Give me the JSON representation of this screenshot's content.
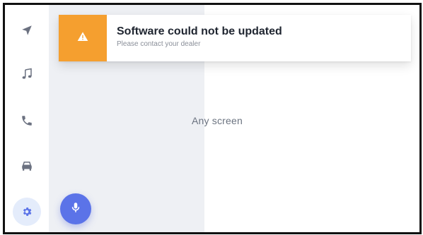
{
  "colors": {
    "accent": "#5b73e8",
    "warning": "#f59f2f",
    "active_bg": "#e4ecfb",
    "rail_icon": "#6b7180",
    "panel_left": "#eef0f4"
  },
  "sidebar": {
    "items": [
      {
        "name": "navigation",
        "icon": "navigation-arrow-icon",
        "active": false
      },
      {
        "name": "music",
        "icon": "music-note-icon",
        "active": false
      },
      {
        "name": "phone",
        "icon": "phone-icon",
        "active": false
      },
      {
        "name": "vehicle",
        "icon": "car-icon",
        "active": false
      },
      {
        "name": "settings",
        "icon": "gear-icon",
        "active": true
      }
    ]
  },
  "notification": {
    "icon": "warning-triangle-icon",
    "title": "Software could not be updated",
    "subtitle": "Please contact your dealer"
  },
  "main": {
    "placeholder": "Any screen"
  },
  "voice": {
    "icon": "microphone-icon"
  }
}
